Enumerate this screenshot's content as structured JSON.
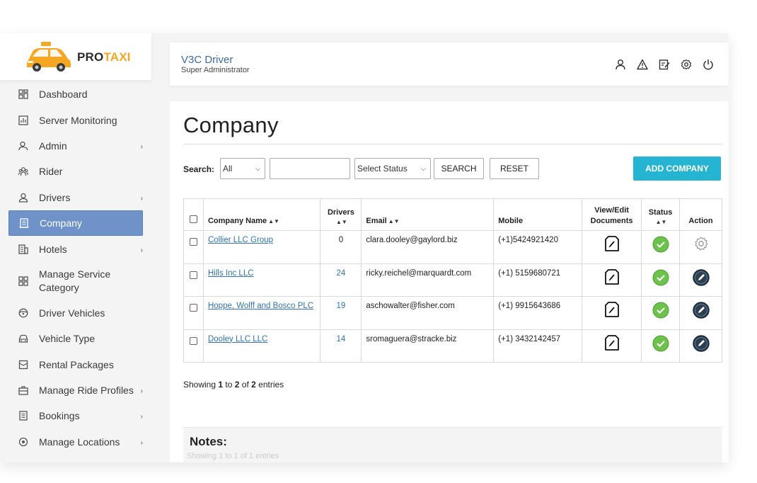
{
  "brand": {
    "pro": "PRO",
    "taxi": "TAXI"
  },
  "sidebar": {
    "items": [
      {
        "label": "Dashboard",
        "icon": "dashboard-icon",
        "chevron": false,
        "active": false
      },
      {
        "label": "Server Monitoring",
        "icon": "chart-icon",
        "chevron": false,
        "active": false
      },
      {
        "label": "Admin",
        "icon": "user-icon",
        "chevron": true,
        "active": false
      },
      {
        "label": "Rider",
        "icon": "users-icon",
        "chevron": false,
        "active": false
      },
      {
        "label": "Drivers",
        "icon": "driver-icon",
        "chevron": true,
        "active": false
      },
      {
        "label": "Company",
        "icon": "building-icon",
        "chevron": false,
        "active": true
      },
      {
        "label": "Hotels",
        "icon": "hotel-icon",
        "chevron": true,
        "active": false
      },
      {
        "label": "Manage Service Category",
        "icon": "grid-icon",
        "chevron": false,
        "active": false
      },
      {
        "label": "Driver Vehicles",
        "icon": "steering-icon",
        "chevron": false,
        "active": false
      },
      {
        "label": "Vehicle Type",
        "icon": "car-icon",
        "chevron": false,
        "active": false
      },
      {
        "label": "Rental Packages",
        "icon": "package-icon",
        "chevron": false,
        "active": false
      },
      {
        "label": "Manage Ride Profiles",
        "icon": "briefcase-icon",
        "chevron": true,
        "active": false
      },
      {
        "label": "Bookings",
        "icon": "list-icon",
        "chevron": true,
        "active": false
      },
      {
        "label": "Manage Locations",
        "icon": "location-icon",
        "chevron": true,
        "active": false
      }
    ]
  },
  "header": {
    "title": "V3C Driver",
    "subtitle": "Super Administrator"
  },
  "page": {
    "title": "Company",
    "search_label": "Search:",
    "filter_value": "All",
    "search_value": "",
    "status_value": "Select Status",
    "search_button": "SEARCH",
    "reset_button": "RESET",
    "add_button": "ADD COMPANY"
  },
  "table": {
    "headers": {
      "name": "Company Name",
      "drivers": "Drivers",
      "email": "Email",
      "mobile": "Mobile",
      "docs1": "View/Edit",
      "docs2": "Documents",
      "status": "Status",
      "action": "Action"
    },
    "rows": [
      {
        "name": "Collier LLC Group",
        "drivers": "0",
        "email": "clara.dooley@gaylord.biz",
        "mobile": "(+1)5424921420",
        "action_icon": "gear-icon"
      },
      {
        "name": "Hills Inc LLC",
        "drivers": "24",
        "email": "ricky.reichel@marquardt.com",
        "mobile": "(+1) 5159680721",
        "action_icon": "edit-icon"
      },
      {
        "name": "Hoppe, Wolff and Bosco PLC",
        "drivers": "19",
        "email": "aschowalter@fisher.com",
        "mobile": "(+1) 9915643686",
        "action_icon": "edit-icon"
      },
      {
        "name": "Dooley LLC LLC",
        "drivers": "14",
        "email": "sromaguera@stracke.biz",
        "mobile": "(+1) 3432142457",
        "action_icon": "edit-icon"
      }
    ]
  },
  "info": {
    "prefix": "Showing ",
    "from": "1",
    "to_word": " to ",
    "to": "2",
    "of_word": " of ",
    "total": "2",
    "suffix": " entries"
  },
  "notes": {
    "title": "Notes:",
    "ghost": "Showing 1 to 1 of 1 entries"
  },
  "colors": {
    "accent": "#25b4d2",
    "active_nav": "#6f93c8",
    "link": "#2f73b8",
    "status_green": "#6cc24a",
    "action_dark": "#2c3e50"
  }
}
